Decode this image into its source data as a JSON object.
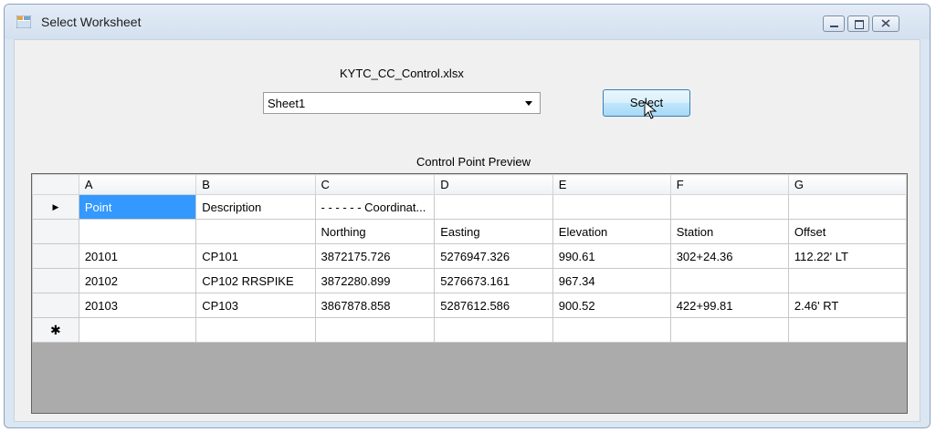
{
  "window": {
    "title": "Select Worksheet"
  },
  "file": {
    "name": "KYTC_CC_Control.xlsx"
  },
  "sheet_select": {
    "value": "Sheet1"
  },
  "buttons": {
    "select": "Select"
  },
  "preview": {
    "label": "Control Point Preview",
    "columns": [
      "A",
      "B",
      "C",
      "D",
      "E",
      "F",
      "G"
    ],
    "rows": [
      [
        "Point",
        "Description",
        "- - - - - - Coordinat...",
        "",
        "",
        "",
        ""
      ],
      [
        "",
        "",
        "Northing",
        "Easting",
        "Elevation",
        "Station",
        "Offset"
      ],
      [
        "20101",
        "CP101",
        "3872175.726",
        "5276947.326",
        "990.61",
        "302+24.36",
        "112.22' LT"
      ],
      [
        "20102",
        "CP102 RRSPIKE",
        "3872280.899",
        "5276673.161",
        "967.34",
        "",
        ""
      ],
      [
        "20103",
        "CP103",
        "3867878.858",
        "5287612.586",
        "900.52",
        "422+99.81",
        "2.46' RT"
      ],
      [
        "",
        "",
        "",
        "",
        "",
        "",
        ""
      ]
    ],
    "row_markers": [
      "▶",
      "",
      "",
      "",
      "",
      "✱"
    ]
  }
}
